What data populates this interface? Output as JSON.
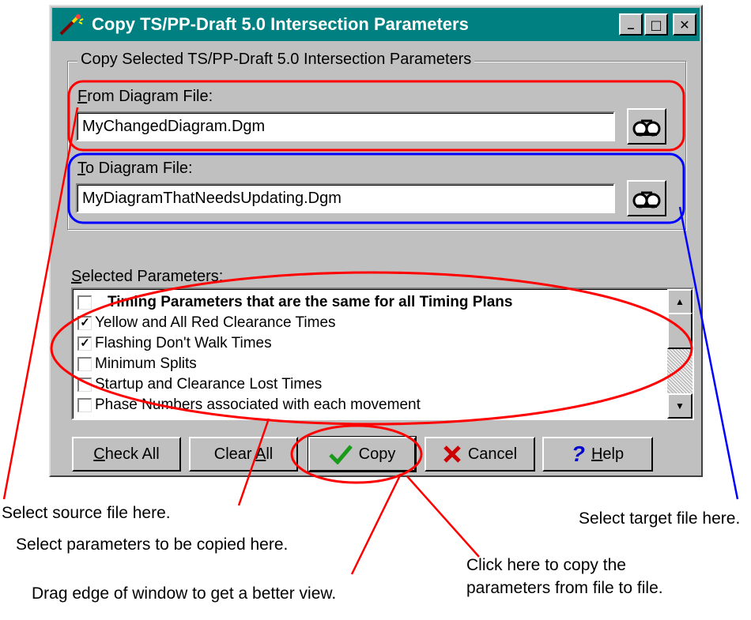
{
  "window": {
    "title": "Copy TS/PP-Draft 5.0 Intersection Parameters",
    "controls": {
      "minimize": "_",
      "maximize": "□",
      "close": "✕"
    }
  },
  "group": {
    "legend": "Copy Selected TS/PP-Draft 5.0 Intersection Parameters"
  },
  "from": {
    "label_u": "F",
    "label_rest": "rom Diagram File:",
    "value": "MyChangedDiagram.Dgm"
  },
  "to": {
    "label_u": "T",
    "label_rest": "o Diagram File:",
    "value": "MyDiagramThatNeedsUpdating.Dgm"
  },
  "params": {
    "label_u": "S",
    "label_rest": "elected Parameters:",
    "items": [
      {
        "label": "Timing Parameters that are the same for all Timing Plans",
        "checked": false,
        "bold": true
      },
      {
        "label": "Yellow and All Red Clearance Times",
        "checked": true
      },
      {
        "label": "Flashing Don't Walk Times",
        "checked": true
      },
      {
        "label": "Minimum Splits",
        "checked": false
      },
      {
        "label": "Startup and Clearance Lost Times",
        "checked": false
      },
      {
        "label": "Phase Numbers associated with each movement",
        "checked": false
      }
    ]
  },
  "buttons": {
    "check_all": {
      "u": "C",
      "rest": "heck All"
    },
    "clear_all": {
      "pre": "Clear ",
      "u": "A",
      "rest": "ll"
    },
    "copy": "Copy",
    "cancel": "Cancel",
    "help": {
      "u": "H",
      "rest": "elp"
    }
  },
  "annotations": {
    "source": "Select source file here.",
    "target": "Select target file here.",
    "params": "Select parameters to be copied here.",
    "copy_line1": "Click here to copy the",
    "copy_line2": "parameters from file to file.",
    "drag": "Drag edge of window to get a better view."
  },
  "colors": {
    "title_bar": "#008080",
    "red_callout": "#ff0000",
    "blue_callout": "#0000ff",
    "check_green": "#1a9a1a",
    "cancel_red": "#cc0000",
    "help_blue": "#0000cc"
  }
}
